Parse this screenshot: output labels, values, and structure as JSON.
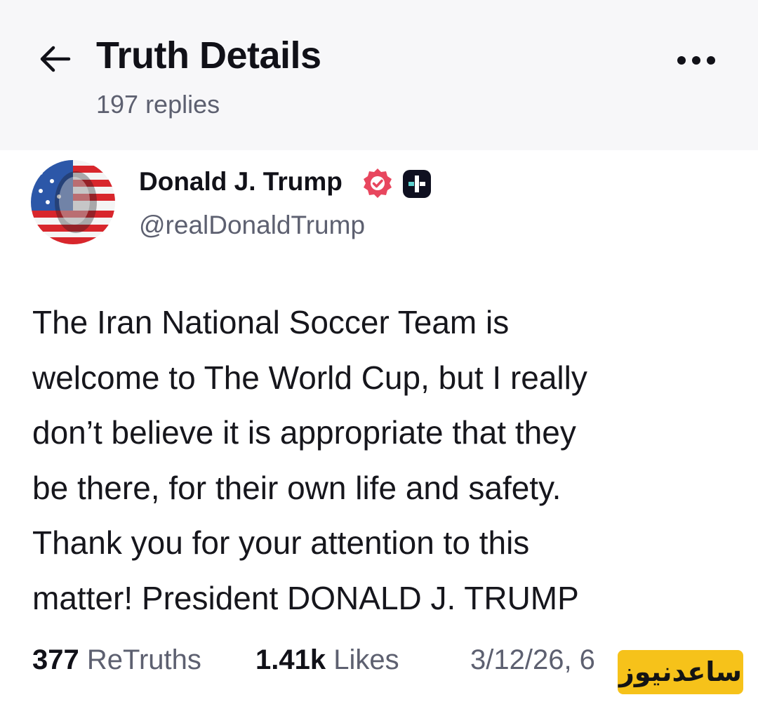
{
  "header": {
    "title": "Truth Details",
    "replies": "197 replies",
    "back_icon": "arrow-left-icon",
    "more_icon": "more-horizontal-icon"
  },
  "author": {
    "name": "Donald J. Trump",
    "handle": "@realDonaldTrump",
    "verified_icon": "verified-badge-icon",
    "plus_icon": "truth-plus-icon",
    "verified_color": "#e8465e"
  },
  "post": {
    "lines": [
      "The Iran National Soccer Team is",
      "welcome to The World Cup, but I really",
      "don’t believe it is appropriate that they",
      "be there, for their own life and safety.",
      "Thank you for your attention to this",
      "matter! President DONALD J. TRUMP"
    ]
  },
  "stats": {
    "retruths_count": "377",
    "retruths_label": "ReTruths",
    "likes_count": "1.41k",
    "likes_label": "Likes",
    "timestamp": "3/12/26, 6"
  },
  "watermark": {
    "text": "ساعدنیوز",
    "color": "#f6c21a"
  }
}
